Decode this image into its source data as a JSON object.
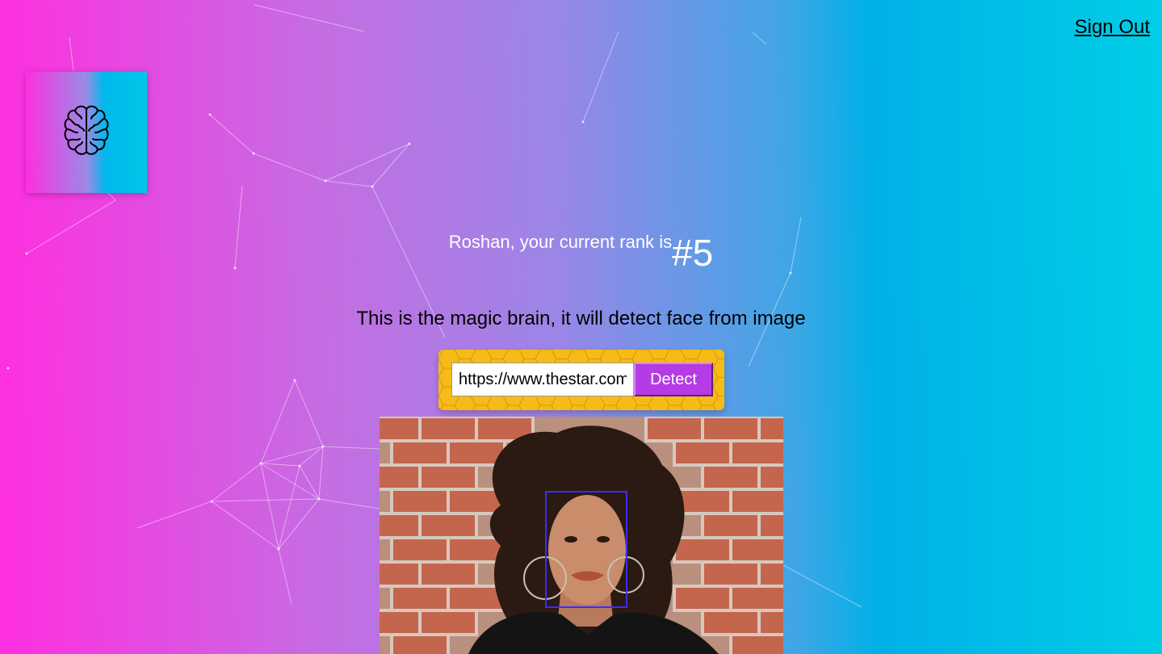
{
  "nav": {
    "signout_label": "Sign Out"
  },
  "logo": {
    "icon": "brain-icon"
  },
  "rank": {
    "text": "Roshan, your current rank is",
    "number": "#5"
  },
  "tagline": "This is the magic brain, it will detect face from image",
  "form": {
    "url_value": "https://www.thestar.com",
    "detect_label": "Detect"
  },
  "colors": {
    "gradient_left": "#ff2ee0",
    "gradient_right": "#00cee6",
    "form_bg": "#f6bb16",
    "button_bg": "#b43be6",
    "face_box": "#3b2cff"
  }
}
